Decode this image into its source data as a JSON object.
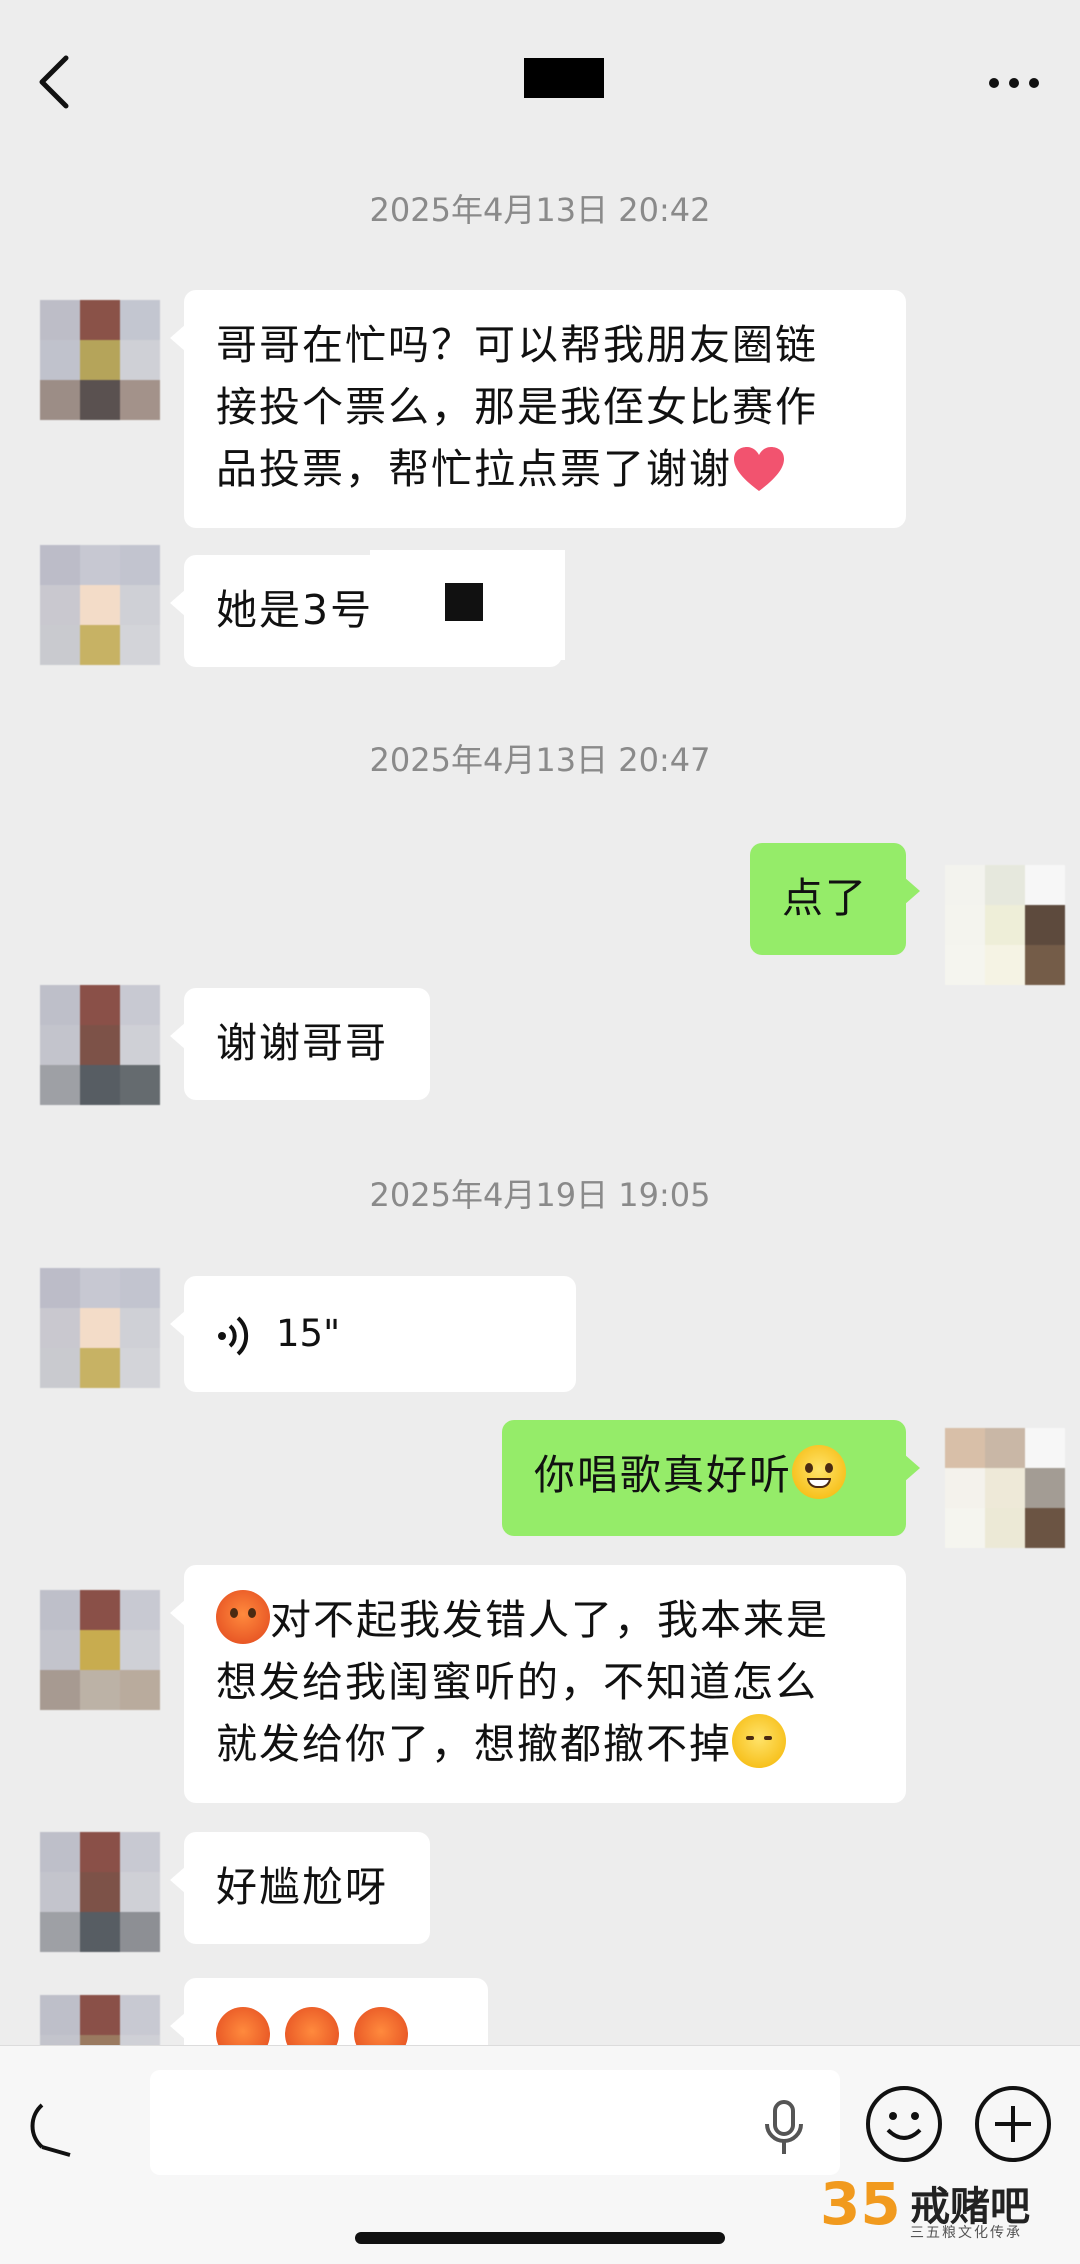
{
  "header": {
    "title": "",
    "back": "back",
    "more": "more"
  },
  "timestamps": [
    "2025年4月13日 20:42",
    "2025年4月13日 20:47",
    "2025年4月19日 19:05"
  ],
  "messages": {
    "m1_l1": "哥哥在忙吗？可以帮我朋友圈链",
    "m1_l2": "接投个票么，那是我侄女比赛作",
    "m1_l3": "品投票，帮忙拉点票了谢谢",
    "m2": "她是3号",
    "m3": "点了",
    "m4": "谢谢哥哥",
    "m5_duration": "15\"",
    "m6": "你唱歌真好听",
    "m7_l1": "对不起我发错人了，我本来是",
    "m7_l2": "想发给我闺蜜听的，不知道怎么",
    "m7_l3": "就发给你了，想撤都撤不掉",
    "m8": "好尴尬呀"
  },
  "icons": {
    "back": "chevron-left-icon",
    "more": "more-dots-icon",
    "voice": "voice-wave-icon",
    "mic": "microphone-icon",
    "emoji": "smiley-icon",
    "plus": "plus-icon",
    "heart": "heart-icon",
    "angry": "angry-face-icon",
    "grin": "grin-face-icon",
    "sad": "sad-face-icon"
  },
  "watermark": {
    "number": "35",
    "name": "戒赌吧",
    "sub": "三五粮文化传承"
  },
  "colors": {
    "background": "#ededed",
    "incoming": "#ffffff",
    "outgoing": "#95ec69"
  }
}
